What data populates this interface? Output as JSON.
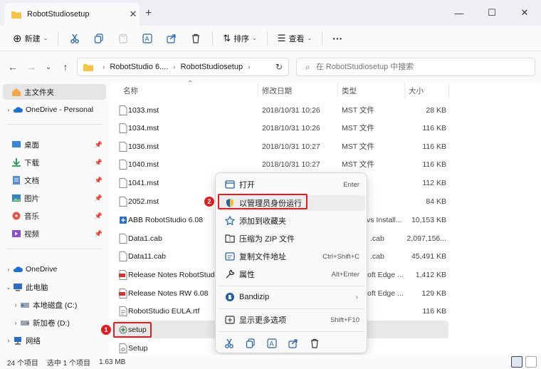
{
  "window": {
    "tab_title": "RobotStudiosetup",
    "new_tab": "+",
    "close_tab": "✕",
    "minimize": "—",
    "maximize": "☐",
    "close": "✕"
  },
  "toolbar": {
    "new_label": "新建",
    "sort_label": "排序",
    "view_label": "查看",
    "more_label": "···"
  },
  "address": {
    "crumbs": [
      "RobotStudio 6....",
      "RobotStudiosetup"
    ],
    "search_placeholder": "在 RobotStudiosetup 中搜索"
  },
  "sidebar": {
    "home": "主文件夹",
    "onedrive_personal": "OneDrive - Personal",
    "quick": [
      {
        "label": "桌面",
        "icon": "desktop-icon"
      },
      {
        "label": "下载",
        "icon": "download-icon"
      },
      {
        "label": "文档",
        "icon": "documents-icon"
      },
      {
        "label": "图片",
        "icon": "pictures-icon"
      },
      {
        "label": "音乐",
        "icon": "music-icon"
      },
      {
        "label": "视频",
        "icon": "videos-icon"
      }
    ],
    "onedrive": "OneDrive",
    "this_pc": "此电脑",
    "drives": [
      "本地磁盘 (C:)",
      "新加卷 (D:)"
    ],
    "network": "网络"
  },
  "columns": {
    "name": "名称",
    "date": "修改日期",
    "type": "类型",
    "size": "大小"
  },
  "files": [
    {
      "name": "1033.mst",
      "date": "2018/10/31 10:26",
      "type": "MST 文件",
      "size": "28 KB",
      "icon": "file"
    },
    {
      "name": "1034.mst",
      "date": "2018/10/31 10:26",
      "type": "MST 文件",
      "size": "116 KB",
      "icon": "file"
    },
    {
      "name": "1036.mst",
      "date": "2018/10/31 10:27",
      "type": "MST 文件",
      "size": "116 KB",
      "icon": "file"
    },
    {
      "name": "1040.mst",
      "date": "2018/10/31 10:27",
      "type": "MST 文件",
      "size": "116 KB",
      "icon": "file"
    },
    {
      "name": "1041.mst",
      "date": "",
      "type": "",
      "size": "112 KB",
      "icon": "file"
    },
    {
      "name": "2052.mst",
      "date": "",
      "type": "",
      "size": "84 KB",
      "icon": "file"
    },
    {
      "name": "ABB RobotStudio 6.08",
      "date": "",
      "type": "vs Install...",
      "size": "10,153 KB",
      "icon": "msi"
    },
    {
      "name": "Data1.cab",
      "date": "",
      "type": ".cab",
      "size": "2,097,156...",
      "icon": "file"
    },
    {
      "name": "Data11.cab",
      "date": "",
      "type": ".cab",
      "size": "45,491 KB",
      "icon": "file"
    },
    {
      "name": "Release Notes RobotStudio",
      "date": "",
      "type": "oft Edge ...",
      "size": "1,412 KB",
      "icon": "pdf"
    },
    {
      "name": "Release Notes RW 6.08",
      "date": "",
      "type": "oft Edge ...",
      "size": "129 KB",
      "icon": "pdf"
    },
    {
      "name": "RobotStudio EULA.rtf",
      "date": "",
      "type": "",
      "size": "116 KB",
      "icon": "file"
    },
    {
      "name": "setup",
      "date": "",
      "type": "",
      "size": "",
      "icon": "setup"
    },
    {
      "name": "Setup",
      "date": "",
      "type": "",
      "size": "",
      "icon": "ini"
    }
  ],
  "context_menu": {
    "items": [
      {
        "label": "打开",
        "shortcut": "Enter",
        "icon": "open-icon"
      },
      {
        "label": "以管理员身份运行",
        "shortcut": "",
        "icon": "shield-icon"
      },
      {
        "label": "添加到收藏夹",
        "shortcut": "",
        "icon": "star-icon"
      },
      {
        "label": "压缩为 ZIP 文件",
        "shortcut": "",
        "icon": "zip-icon"
      },
      {
        "label": "复制文件地址",
        "shortcut": "Ctrl+Shift+C",
        "icon": "copy-path-icon"
      },
      {
        "label": "属性",
        "shortcut": "Alt+Enter",
        "icon": "wrench-icon"
      },
      {
        "label": "Bandizip",
        "shortcut": "",
        "icon": "bandizip-icon"
      },
      {
        "label": "显示更多选项",
        "shortcut": "Shift+F10",
        "icon": "more-options-icon"
      }
    ],
    "bottom_icons": [
      "cut-icon",
      "copy-icon",
      "rename-icon",
      "share-icon",
      "delete-icon"
    ]
  },
  "annotations": {
    "badge_1": "1",
    "badge_2": "2"
  },
  "status": {
    "count": "24 个项目",
    "selected": "选中 1 个项目",
    "size": "1.63 MB"
  },
  "colors": {
    "accent": "#0067c0",
    "highlight_red": "#e02020",
    "folder": "#f4c542"
  }
}
